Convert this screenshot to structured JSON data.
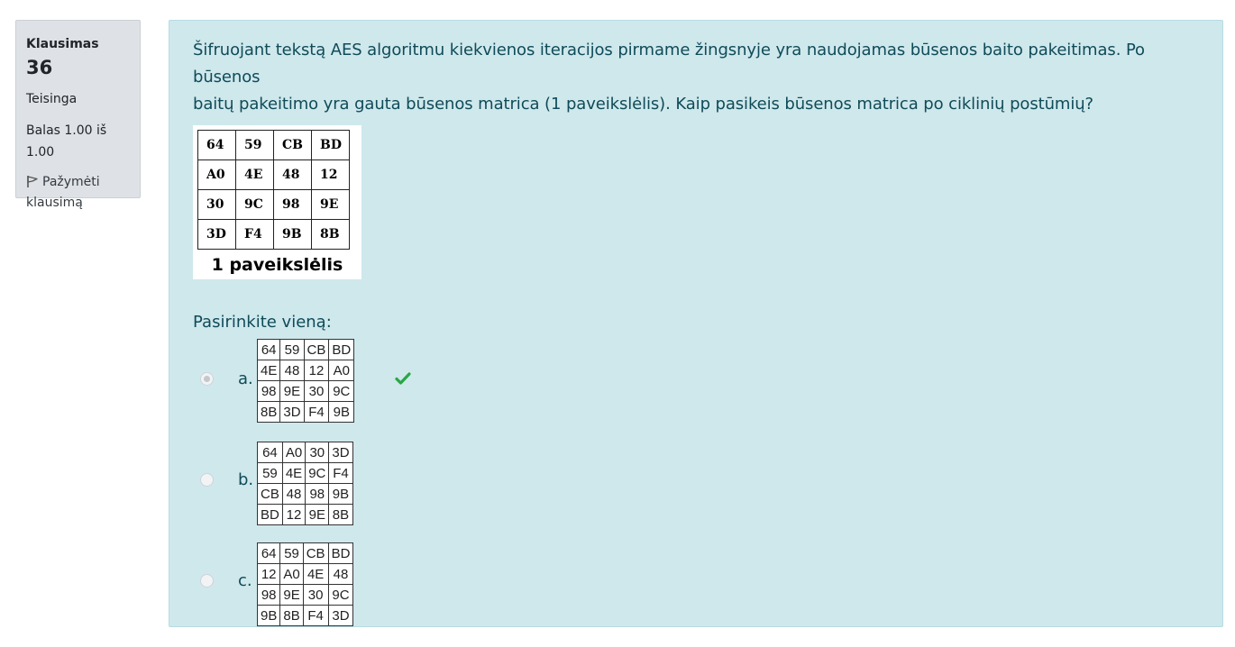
{
  "info": {
    "question_label": "Klausimas",
    "question_number": "36",
    "state": "Teisinga",
    "grade_line1": "Balas 1.00 iš",
    "grade_line2": "1.00",
    "flag_line1": "Pažymėti",
    "flag_line2": "klausimą"
  },
  "question": {
    "text_line1": "Šifruojant tekstą AES algoritmu kiekvienos iteracijos pirmame žingsnyje yra naudojamas būsenos baito pakeitimas. Po būsenos",
    "text_line2": "baitų pakeitimo yra gauta būsenos matrica (1 paveikslėlis). Kaip pasikeis būsenos matrica po ciklinių postūmių?",
    "figure_caption": "1 paveikslėlis",
    "figure_matrix": [
      [
        "64",
        "59",
        "CB",
        "BD"
      ],
      [
        "A0",
        "4E",
        "48",
        "12"
      ],
      [
        "30",
        "9C",
        "98",
        "9E"
      ],
      [
        "3D",
        "F4",
        "9B",
        "8B"
      ]
    ],
    "prompt": "Pasirinkite vieną:"
  },
  "answers": [
    {
      "letter": "a.",
      "selected": true,
      "correct": true,
      "matrix": [
        [
          "64",
          "59",
          "CB",
          "BD"
        ],
        [
          "4E",
          "48",
          "12",
          "A0"
        ],
        [
          "98",
          "9E",
          "30",
          "9C"
        ],
        [
          "8B",
          "3D",
          "F4",
          "9B"
        ]
      ]
    },
    {
      "letter": "b.",
      "selected": false,
      "correct": false,
      "matrix": [
        [
          "64",
          "A0",
          "30",
          "3D"
        ],
        [
          "59",
          "4E",
          "9C",
          "F4"
        ],
        [
          "CB",
          "48",
          "98",
          "9B"
        ],
        [
          "BD",
          "12",
          "9E",
          "8B"
        ]
      ]
    },
    {
      "letter": "c.",
      "selected": false,
      "correct": false,
      "matrix": [
        [
          "64",
          "59",
          "CB",
          "BD"
        ],
        [
          "12",
          "A0",
          "4E",
          "48"
        ],
        [
          "98",
          "9E",
          "30",
          "9C"
        ],
        [
          "9B",
          "8B",
          "F4",
          "3D"
        ]
      ]
    }
  ],
  "colors": {
    "content_bg": "#cfe8ec",
    "content_text": "#0f4b58",
    "info_bg": "#dee2e6",
    "correct_check": "#28a745"
  },
  "icons": {
    "flag": "flag-icon",
    "correct": "check-icon"
  }
}
